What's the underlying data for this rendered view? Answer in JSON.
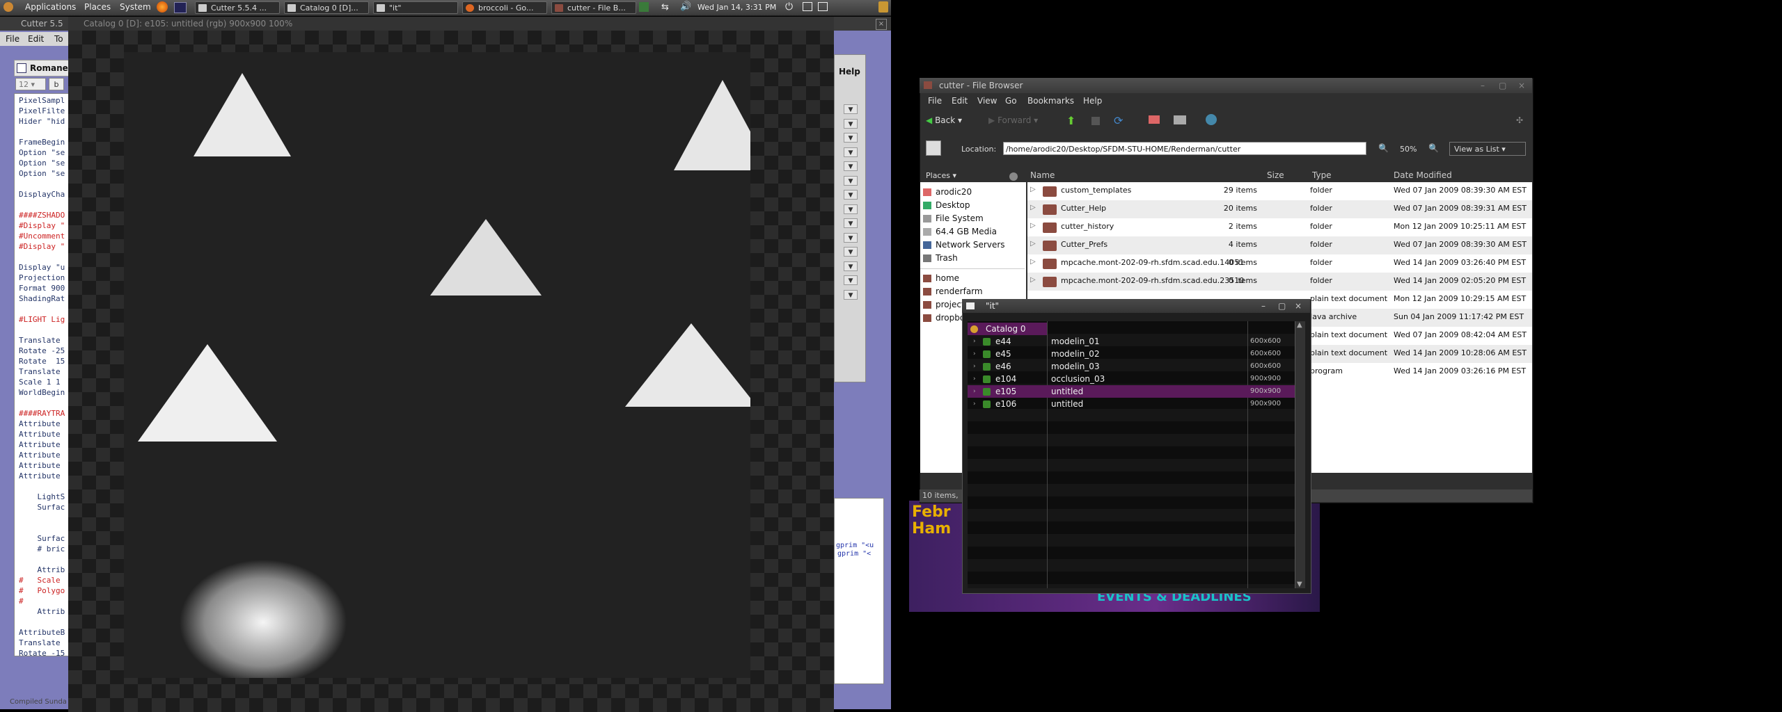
{
  "panel": {
    "menus": [
      "Applications",
      "Places",
      "System"
    ],
    "tasks": [
      {
        "label": "Cutter 5.5.4 ..."
      },
      {
        "label": "Catalog 0 [D]..."
      },
      {
        "label": "\"it\""
      },
      {
        "label": "broccoli - Go..."
      },
      {
        "label": "cutter - File B..."
      }
    ],
    "clock": "Wed Jan 14,  3:31 PM"
  },
  "cutter": {
    "title": "Cutter 5.5",
    "menu": [
      "File",
      "Edit",
      "To"
    ],
    "doc_tab": "Romanes",
    "font_size": "12",
    "bold_btn": "b",
    "help_button": "Help",
    "status": "Compiled Sunda",
    "code_lines": [
      "PixelSampl",
      "PixelFilte",
      "Hider \"hid",
      "",
      "FrameBegin",
      "Option \"se",
      "Option \"se",
      "Option \"se",
      "",
      "DisplayCha",
      "",
      "####ZSHADO",
      "#Display \"",
      "#Uncomment",
      "#Display \"",
      "",
      "Display \"u",
      "Projection",
      "Format 900",
      "ShadingRat",
      "",
      "#LIGHT Lig",
      "",
      "Translate",
      "Rotate -25",
      "Rotate  15",
      "Translate",
      "Scale 1 1",
      "WorldBegin",
      "",
      "####RAYTRA",
      "Attribute",
      "Attribute",
      "Attribute",
      "Attribute",
      "Attribute",
      "Attribute",
      "",
      "    LightS",
      "    Surfac",
      "",
      "",
      "    Surfac",
      "    # bric",
      "",
      "    Attrib",
      "#   Scale",
      "#   Polygo",
      "#",
      "    Attrib",
      "",
      "AttributeB",
      "Translate",
      "Rotate -15"
    ],
    "side_code": [
      "gprim \"<u",
      "gprim \"<"
    ]
  },
  "catalog_window": {
    "title": "Catalog 0 [D]:  e105: untitled (rgb) 900x900 100%"
  },
  "file_browser": {
    "title": "cutter - File Browser",
    "menu": [
      "File",
      "Edit",
      "View",
      "Go",
      "Bookmarks",
      "Help"
    ],
    "back_label": "Back",
    "forward_label": "Forward",
    "location_label": "Location:",
    "location_value": "/home/arodic20/Desktop/SFDM-STU-HOME/Renderman/cutter",
    "zoom": "50%",
    "view_mode": "View as List",
    "places_label": "Places",
    "places": [
      {
        "label": "arodic20",
        "icon": "home-icon"
      },
      {
        "label": "Desktop",
        "icon": "desktop-icon"
      },
      {
        "label": "File System",
        "icon": "filesystem-icon"
      },
      {
        "label": "64.4 GB Media",
        "icon": "drive-icon"
      },
      {
        "label": "Network Servers",
        "icon": "network-icon"
      },
      {
        "label": "Trash",
        "icon": "trash-icon"
      },
      {
        "label": "home",
        "icon": "folder-icon"
      },
      {
        "label": "renderfarm",
        "icon": "folder-icon"
      },
      {
        "label": "project",
        "icon": "folder-icon"
      },
      {
        "label": "dropbo",
        "icon": "folder-icon"
      }
    ],
    "columns": [
      "Name",
      "Size",
      "Type",
      "Date Modified"
    ],
    "rows": [
      {
        "name": "custom_templates",
        "size": "29 items",
        "type": "folder",
        "date": "Wed 07 Jan 2009 08:39:30 AM EST"
      },
      {
        "name": "Cutter_Help",
        "size": "20 items",
        "type": "folder",
        "date": "Wed 07 Jan 2009 08:39:31 AM EST"
      },
      {
        "name": "cutter_history",
        "size": "2 items",
        "type": "folder",
        "date": "Mon 12 Jan 2009 10:25:11 AM EST"
      },
      {
        "name": "Cutter_Prefs",
        "size": "4 items",
        "type": "folder",
        "date": "Wed 07 Jan 2009 08:39:30 AM EST"
      },
      {
        "name": "mpcache.mont-202-09-rh.sfdm.scad.edu.14051",
        "size": "0 items",
        "type": "folder",
        "date": "Wed 14 Jan 2009 03:26:40 PM EST"
      },
      {
        "name": "mpcache.mont-202-09-rh.sfdm.scad.edu.23510",
        "size": "0 items",
        "type": "folder",
        "date": "Wed 14 Jan 2009 02:05:20 PM EST"
      },
      {
        "name": "",
        "size": "",
        "type": "plain text document",
        "date": "Mon 12 Jan 2009 10:29:15 AM EST"
      },
      {
        "name": "",
        "size": "",
        "type": "Java archive",
        "date": "Sun 04 Jan 2009 11:17:42 PM EST"
      },
      {
        "name": "",
        "size": "",
        "type": "plain text document",
        "date": "Wed 07 Jan 2009 08:42:04 AM EST"
      },
      {
        "name": "",
        "size": "",
        "type": "plain text document",
        "date": "Wed 14 Jan 2009 10:28:06 AM EST"
      },
      {
        "name": "",
        "size": "",
        "type": "program",
        "date": "Wed 14 Jan 2009 03:26:16 PM EST"
      }
    ],
    "status": "10 items,"
  },
  "it_window": {
    "title": "\"it\"",
    "catalog": "Catalog 0",
    "items": [
      {
        "id": "e44",
        "name": "modelin_01",
        "size": "600x600"
      },
      {
        "id": "e45",
        "name": "modelin_02",
        "size": "600x600"
      },
      {
        "id": "e46",
        "name": "modelin_03",
        "size": "600x600"
      },
      {
        "id": "e104",
        "name": "occlusion_03",
        "size": "900x900"
      },
      {
        "id": "e105",
        "name": "untitled",
        "size": "900x900"
      },
      {
        "id": "e106",
        "name": "untitled",
        "size": "900x900"
      }
    ]
  },
  "background": {
    "poster_text_1": "Febr",
    "poster_text_2": "Ham",
    "poster_text_3": "EVENTS & DEADLINES"
  }
}
